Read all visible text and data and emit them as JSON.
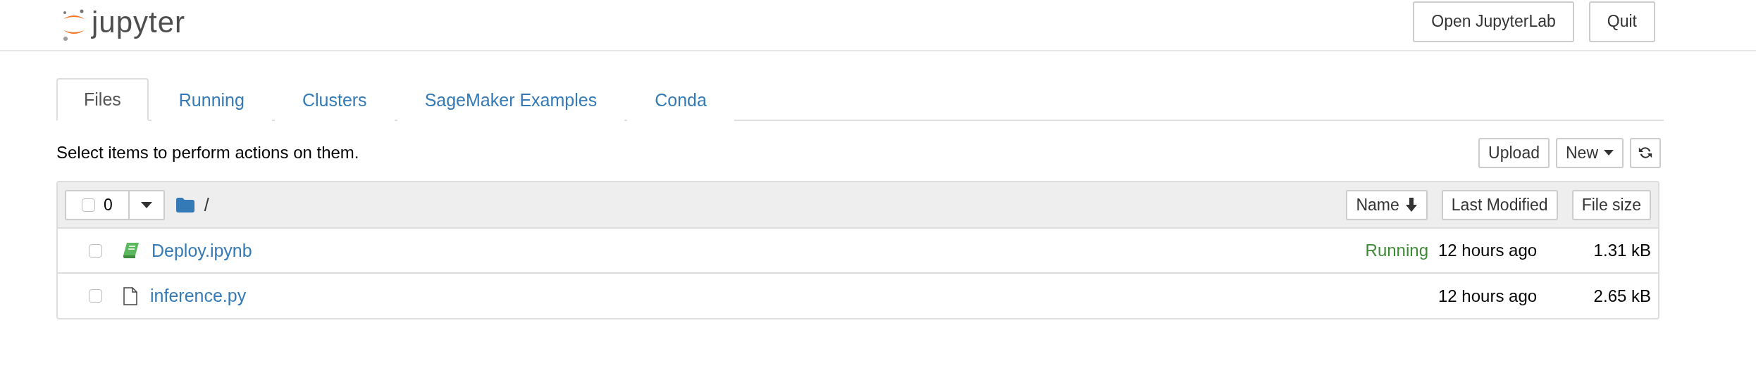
{
  "header": {
    "logo_text": "jupyter",
    "buttons": [
      "Open JupyterLab",
      "Quit"
    ]
  },
  "tabs": [
    {
      "label": "Files",
      "selected": true
    },
    {
      "label": "Running",
      "selected": false
    },
    {
      "label": "Clusters",
      "selected": false
    },
    {
      "label": "SageMaker Examples",
      "selected": false
    },
    {
      "label": "Conda",
      "selected": false
    }
  ],
  "toolbar": {
    "hint": "Select items to perform actions on them.",
    "upload": "Upload",
    "new": "New"
  },
  "list": {
    "select_all": {
      "checked": false,
      "count": "0"
    },
    "path": "/",
    "columns": [
      "Name",
      "Last Modified",
      "File size"
    ],
    "items": [
      {
        "kind": "notebook",
        "name": "Deploy.ipynb",
        "checked": false,
        "status": "Running",
        "modified": "12 hours ago",
        "size": "1.31 kB"
      },
      {
        "kind": "file",
        "name": "inference.py",
        "checked": false,
        "modified": "12 hours ago",
        "size": "2.65 kB"
      }
    ]
  }
}
